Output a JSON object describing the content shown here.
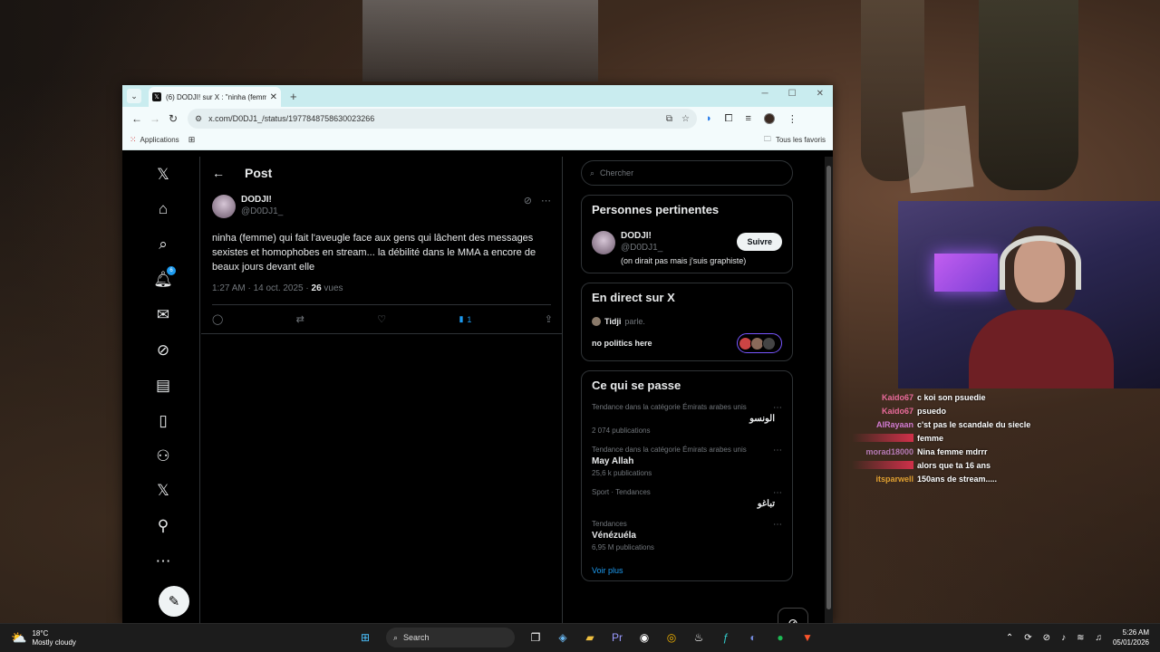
{
  "browser": {
    "tab_title": "(6) DODJI! sur X : \"ninha (femme",
    "url": "x.com/D0DJ1_/status/1977848758630023266",
    "bookmarks_apps": "Applications",
    "bookmarks_all": "Tous les favoris"
  },
  "x": {
    "nav_badge": "6",
    "header_title": "Post",
    "post": {
      "display_name": "DODJI!",
      "handle": "@D0DJ1_",
      "text": "ninha (femme) qui fait l'aveugle face aux gens qui lâchent des messages sexistes et homophobes en stream... la débilité dans le MMA a encore de beaux jours devant elle",
      "time": "1:27 AM · 14 oct. 2025 · ",
      "views_count": "26",
      "views_label": " vues",
      "bookmark_count": "1"
    },
    "search_placeholder": "Chercher",
    "relevant": {
      "title": "Personnes pertinentes",
      "name": "DODJI!",
      "handle": "@D0DJ1_",
      "follow_label": "Suivre",
      "bio": "(on dirait pas mais j'suis graphiste)"
    },
    "live": {
      "title": "En direct sur X",
      "host": "Tidji",
      "verb": "parle.",
      "space_title": "no politics here"
    },
    "trends": {
      "title": "Ce qui se passe",
      "items": [
        {
          "context": "Tendance dans la catégorie Émirats arabes unis",
          "name": "الونسو",
          "count": "2 074 publications",
          "rtl": true
        },
        {
          "context": "Tendance dans la catégorie Émirats arabes unis",
          "name": "May Allah",
          "count": "25,6 k publications",
          "rtl": false
        },
        {
          "context": "Sport · Tendances",
          "name": "تباغو",
          "count": "",
          "rtl": true
        },
        {
          "context": "Tendances",
          "name": "Vénézuéla",
          "count": "6,95 M publications",
          "rtl": false
        }
      ],
      "show_more": "Voir plus"
    }
  },
  "chat": [
    {
      "user": "Kaido67",
      "color": "#e86a9a",
      "text": "c koi son psuedie"
    },
    {
      "user": "Kaido67",
      "color": "#e86a9a",
      "text": "psuedo"
    },
    {
      "user": "AlRayaan",
      "color": "#d07ad0",
      "text": "c'st pas le scandale du siecle"
    },
    {
      "user": "",
      "color": "#d0304a",
      "text": "femme"
    },
    {
      "user": "morad18000",
      "color": "#b57ab5",
      "text": "Nina femme mdrrr"
    },
    {
      "user": "",
      "color": "#d0304a",
      "text": "alors que ta 16 ans"
    },
    {
      "user": "itsparwell",
      "color": "#e0a030",
      "text": "150ans de stream....."
    }
  ],
  "taskbar": {
    "temp": "18°C",
    "weather": "Mostly cloudy",
    "search_label": "Search",
    "time": "5:26 AM",
    "date": "05/01/2026"
  }
}
